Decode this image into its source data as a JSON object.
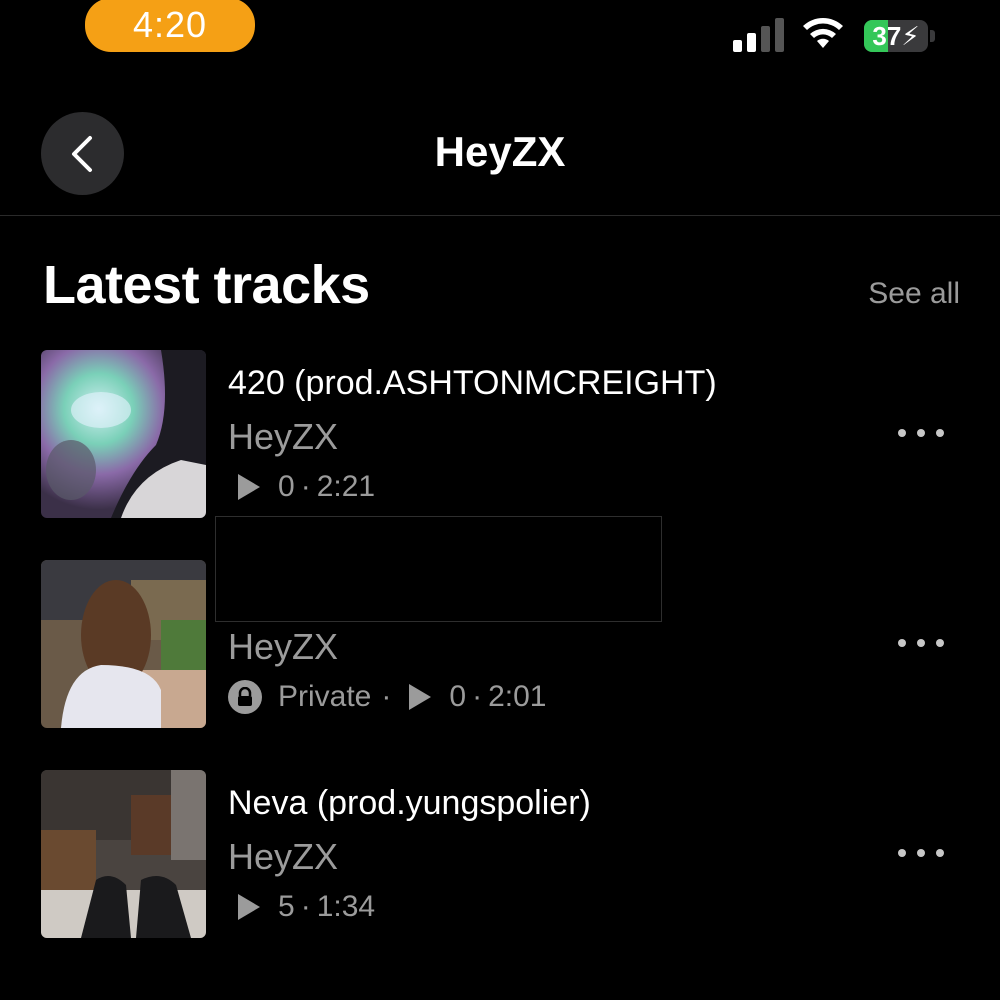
{
  "status_bar": {
    "time": "4:20",
    "battery_level": "37",
    "battery_fraction": 0.37,
    "icons": [
      "signal-icon",
      "wifi-icon",
      "battery-charging-icon"
    ]
  },
  "header": {
    "title": "HeyZX",
    "back_icon": "chevron-left-icon"
  },
  "section": {
    "title": "Latest tracks",
    "see_all": "See all"
  },
  "tracks": [
    {
      "title": "420 (prod.ASHTONMCREIGHT)",
      "artist": "HeyZX",
      "plays": "0",
      "duration": "2:21",
      "private": false
    },
    {
      "title": "",
      "artist": "HeyZX",
      "private_label": "Private",
      "plays": "0",
      "duration": "2:01",
      "private": true
    },
    {
      "title": "Neva (prod.yungspolier)",
      "artist": "HeyZX",
      "plays": "5",
      "duration": "1:34",
      "private": false
    }
  ],
  "colors": {
    "background": "#000000",
    "time_pill": "#f5a015",
    "battery_fill": "#34c759",
    "secondary_text": "#9b9b9b"
  }
}
